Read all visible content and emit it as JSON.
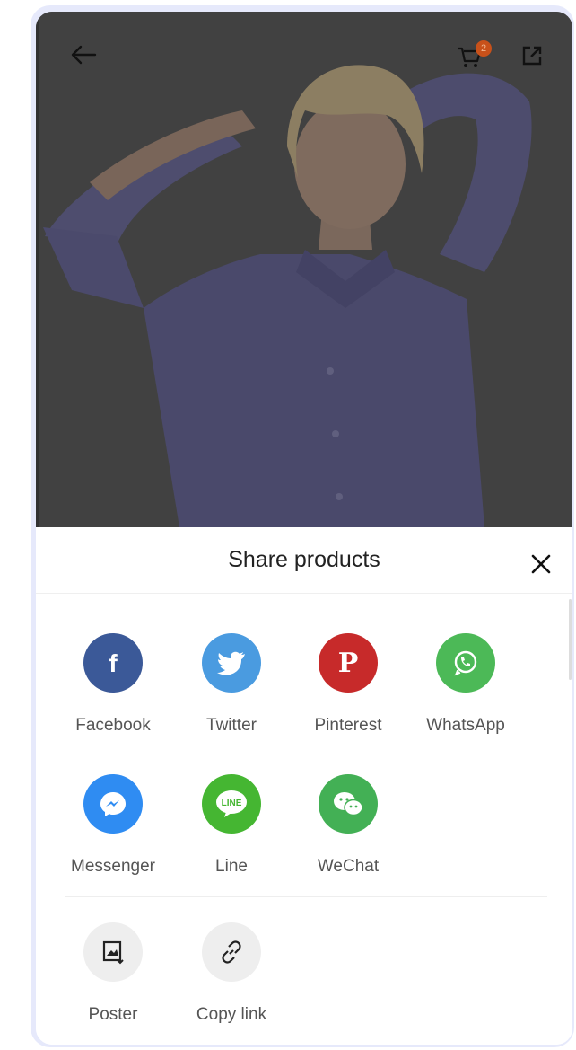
{
  "header": {
    "back_icon": "arrow-left-icon",
    "cart_icon": "cart-icon",
    "cart_count": "2",
    "external_icon": "external-link-icon"
  },
  "sheet": {
    "title": "Share products",
    "close_icon": "close-icon"
  },
  "share_options": [
    {
      "label": "Facebook",
      "icon": "facebook-icon",
      "color": "#3b5998"
    },
    {
      "label": "Twitter",
      "icon": "twitter-icon",
      "color": "#4a9be0"
    },
    {
      "label": "Pinterest",
      "icon": "pinterest-icon",
      "color": "#c72a2a"
    },
    {
      "label": "WhatsApp",
      "icon": "whatsapp-icon",
      "color": "#4cb957"
    },
    {
      "label": "Messenger",
      "icon": "messenger-icon",
      "color": "#2f8cf2"
    },
    {
      "label": "Line",
      "icon": "line-icon",
      "color": "#45b632"
    },
    {
      "label": "WeChat",
      "icon": "wechat-icon",
      "color": "#43b055"
    }
  ],
  "tools": [
    {
      "label": "Poster",
      "icon": "poster-icon",
      "color": "#eeeeee"
    },
    {
      "label": "Copy link",
      "icon": "link-icon",
      "color": "#eeeeee"
    }
  ],
  "line_logo_text": "LINE"
}
